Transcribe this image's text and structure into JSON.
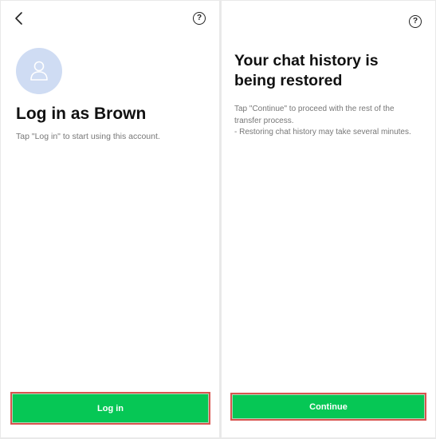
{
  "login_screen": {
    "back_icon": "chevron-left-icon",
    "help_icon_glyph": "?",
    "avatar_icon": "person-icon",
    "title": "Log in as Brown",
    "subtitle": "Tap \"Log in\" to start using this account.",
    "login_button": "Log in"
  },
  "restore_screen": {
    "help_icon_glyph": "?",
    "title_line1": "Your chat history is",
    "title_line2": "being restored",
    "desc_line1": "Tap \"Continue\" to proceed with the rest of the",
    "desc_line2": "transfer process.",
    "desc_line3": "- Restoring chat history may take several minutes.",
    "continue_button": "Continue"
  },
  "colors": {
    "brand_green": "#06c755",
    "highlight_border": "#d9534f",
    "avatar_bg": "#cfdcf3"
  }
}
